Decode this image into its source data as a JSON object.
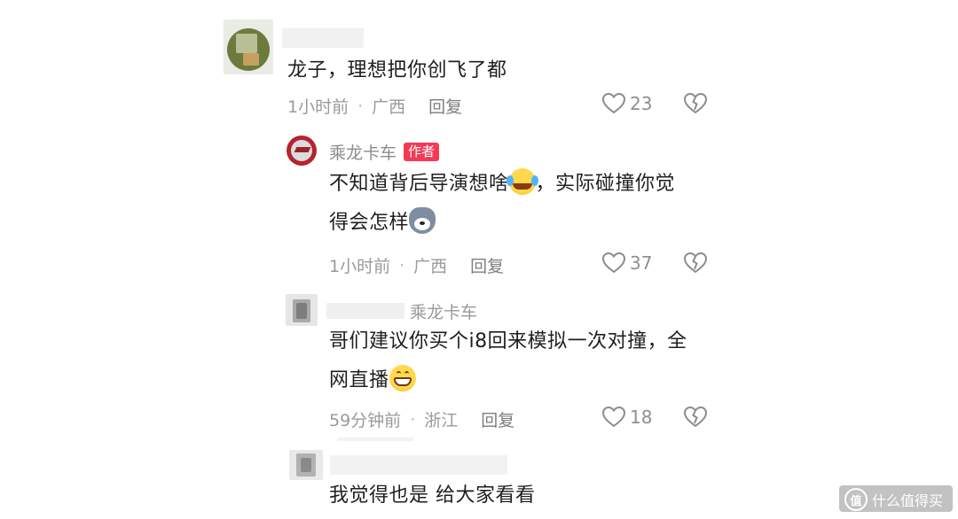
{
  "comments": [
    {
      "text": "龙子，理想把你创飞了都",
      "time": "1小时前",
      "location": "广西",
      "reply": "回复",
      "likes": "23",
      "replies": [
        {
          "author": "乘龙卡车",
          "badge": "作者",
          "text_line1": "不知道背后导演想啥",
          "text_line1b": "，实际碰撞你觉",
          "text_line2": "得会怎样",
          "time": "1小时前",
          "location": "广西",
          "reply": "回复",
          "likes": "37"
        },
        {
          "reply_to": "乘龙卡车",
          "text_line1": "哥们建议你买个i8回来模拟一次对撞，全",
          "text_line2": "网直播",
          "time": "59分钟前",
          "location": "浙江",
          "reply": "回复",
          "likes": "18"
        },
        {
          "text_line1": "我觉得也是 给大家看看"
        }
      ]
    }
  ],
  "watermark": {
    "icon_glyph": "值",
    "text": "什么值得买"
  },
  "colors": {
    "badge": "#f23a55",
    "meta": "#9a9a9a",
    "text": "#1f1f1f"
  }
}
